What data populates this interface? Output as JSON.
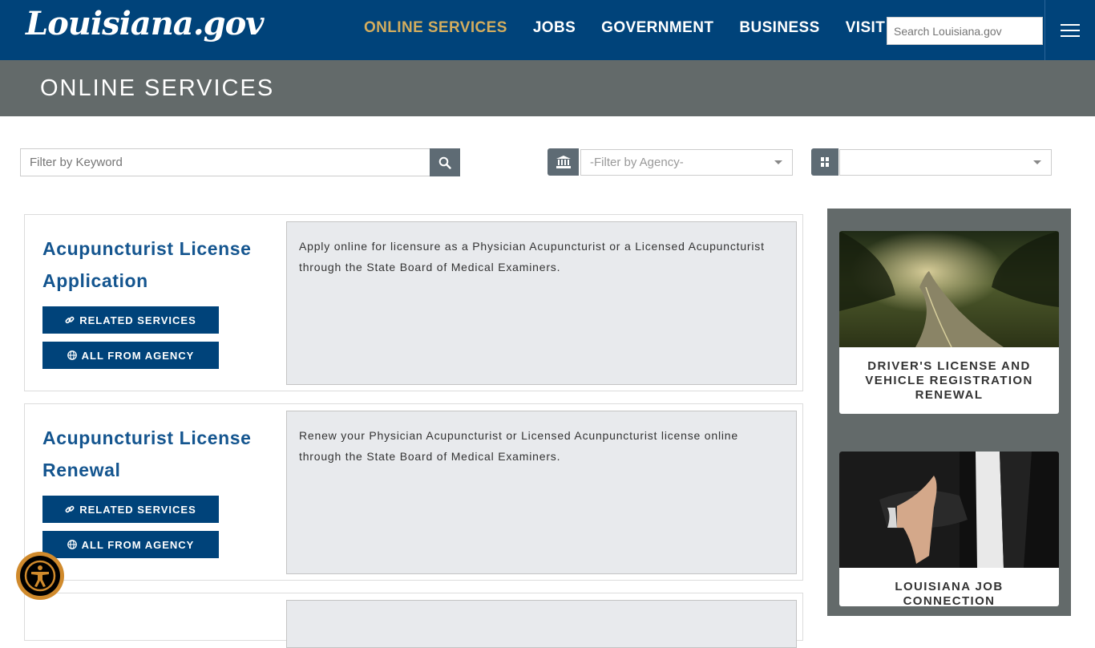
{
  "header": {
    "logo_text": "Louisiana.gov",
    "nav": [
      "ONLINE SERVICES",
      "JOBS",
      "GOVERNMENT",
      "BUSINESS",
      "VISIT"
    ],
    "search_placeholder": "Search Louisiana.gov"
  },
  "banner": {
    "title": "ONLINE SERVICES"
  },
  "filters": {
    "keyword_placeholder": "Filter by Keyword",
    "agency_placeholder": "-Filter by Agency-",
    "category_value": ""
  },
  "services": [
    {
      "title_line1": "Acupuncturist License",
      "title_line2": "Application",
      "description": "Apply online for licensure as a Physician Acupuncturist or a Licensed Acupuncturist through the State Board of Medical Examiners.",
      "related_label": "RELATED SERVICES",
      "agency_label": "ALL FROM AGENCY"
    },
    {
      "title_line1": "Acupuncturist License",
      "title_line2": "Renewal",
      "description": "Renew your Physician Acupuncturist or Licensed Acunpuncturist license online through the State Board of Medical Examiners.",
      "related_label": "RELATED SERVICES",
      "agency_label": "ALL FROM AGENCY"
    }
  ],
  "sidebar": {
    "promos": [
      {
        "label": "DRIVER'S LICENSE AND VEHICLE REGISTRATION RENEWAL"
      },
      {
        "label": "LOUISIANA JOB CONNECTION"
      }
    ]
  },
  "colors": {
    "header_bg": "#00437a",
    "nav_active": "#d3ad5e",
    "banner_bg": "#636a6a",
    "title_blue": "#14558f",
    "button_bg": "#00437a"
  }
}
